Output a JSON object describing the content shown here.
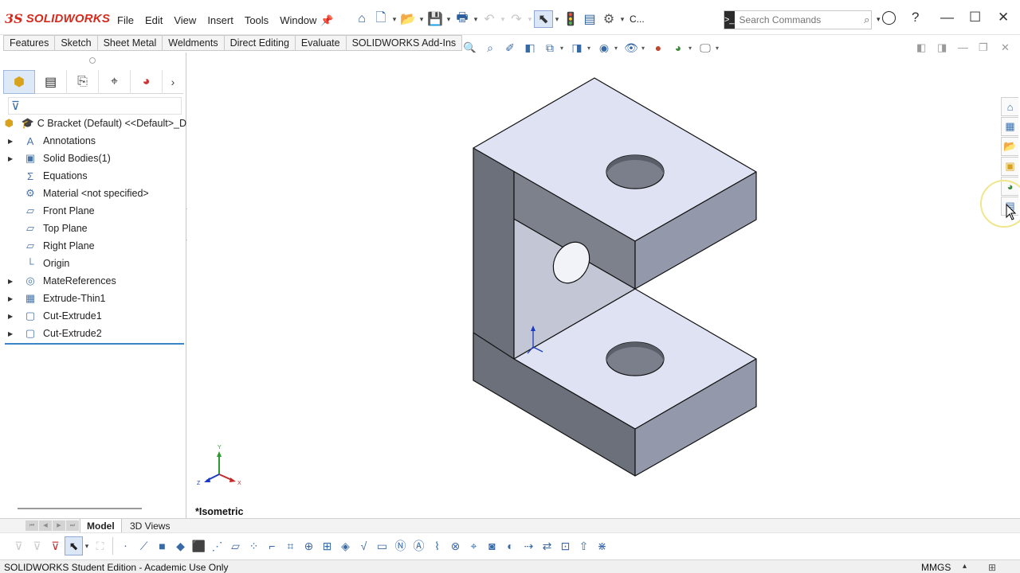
{
  "app": {
    "brand_prefix": "3S",
    "brand_name": "SOLIDWORKS",
    "menu": [
      "File",
      "Edit",
      "View",
      "Insert",
      "Tools",
      "Window"
    ],
    "truncated_label": "C...",
    "search_placeholder": "Search Commands"
  },
  "command_tabs": [
    "Features",
    "Sketch",
    "Sheet Metal",
    "Weldments",
    "Direct Editing",
    "Evaluate",
    "SOLIDWORKS Add-Ins"
  ],
  "tree": {
    "root": "C Bracket (Default) <<Default>_D",
    "items": [
      {
        "label": "Annotations",
        "expandable": true,
        "icon": "annotations-icon",
        "glyph": "A"
      },
      {
        "label": "Solid Bodies(1)",
        "expandable": true,
        "icon": "solid-bodies-icon",
        "glyph": "▣"
      },
      {
        "label": "Equations",
        "expandable": false,
        "icon": "equations-icon",
        "glyph": "Σ"
      },
      {
        "label": "Material <not specified>",
        "expandable": false,
        "icon": "material-icon",
        "glyph": "⚙"
      },
      {
        "label": "Front Plane",
        "expandable": false,
        "icon": "plane-icon",
        "glyph": "▱"
      },
      {
        "label": "Top Plane",
        "expandable": false,
        "icon": "plane-icon",
        "glyph": "▱"
      },
      {
        "label": "Right Plane",
        "expandable": false,
        "icon": "plane-icon",
        "glyph": "▱"
      },
      {
        "label": "Origin",
        "expandable": false,
        "icon": "origin-icon",
        "glyph": "└"
      },
      {
        "label": "MateReferences",
        "expandable": true,
        "icon": "mate-references-icon",
        "glyph": "◎"
      },
      {
        "label": "Extrude-Thin1",
        "expandable": true,
        "icon": "extrude-icon",
        "glyph": "▦"
      },
      {
        "label": "Cut-Extrude1",
        "expandable": true,
        "icon": "cut-extrude-icon",
        "glyph": "▢"
      },
      {
        "label": "Cut-Extrude2",
        "expandable": true,
        "icon": "cut-extrude-icon",
        "glyph": "▢"
      }
    ]
  },
  "view": {
    "name": "*Isometric",
    "triad": {
      "x": "X",
      "y": "Y",
      "z": "Z"
    }
  },
  "bottom_tabs": [
    "Model",
    "3D Views"
  ],
  "status": {
    "message": "SOLIDWORKS Student Edition - Academic Use Only",
    "units": "MMGS"
  },
  "colors": {
    "brand_red": "#d52b1e",
    "accent_blue": "#3b84c5",
    "part_top": "#dfe2f2",
    "part_side": "#9399aa",
    "part_front": "#6b6f7a"
  }
}
